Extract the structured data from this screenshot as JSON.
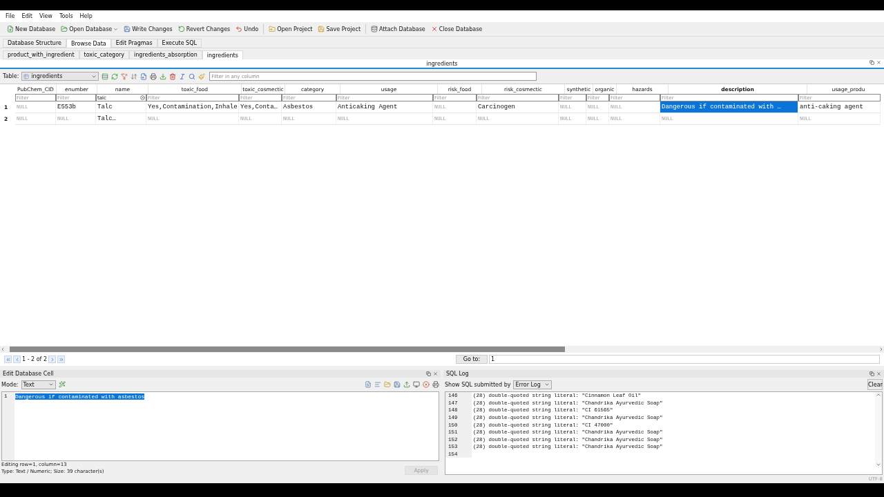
{
  "menu": [
    "File",
    "Edit",
    "View",
    "Tools",
    "Help"
  ],
  "toolbar": [
    {
      "label": "New Database"
    },
    {
      "label": "Open Database",
      "dropdown": true
    },
    {
      "label": "Write Changes"
    },
    {
      "label": "Revert Changes"
    },
    {
      "label": "Undo"
    },
    {
      "label": "Open Project",
      "group_start": true
    },
    {
      "label": "Save Project"
    },
    {
      "label": "Attach Database",
      "group_start": true
    },
    {
      "label": "Close Database"
    }
  ],
  "main_tabs": [
    {
      "label": "Database Structure",
      "selected": false
    },
    {
      "label": "Browse Data",
      "selected": true
    },
    {
      "label": "Edit Pragmas",
      "selected": false
    },
    {
      "label": "Execute SQL",
      "selected": false
    }
  ],
  "table_tabs": [
    {
      "label": "product_with_ingredient",
      "selected": false
    },
    {
      "label": "toxic_category",
      "selected": false
    },
    {
      "label": "ingredients_absorption",
      "selected": false
    },
    {
      "label": "ingredients",
      "selected": true
    }
  ],
  "view_title": "ingredients",
  "table_bar": {
    "label": "Table:",
    "table": "ingredients",
    "filter_placeholder": "Filter in any column"
  },
  "columns": [
    {
      "name": "PubChem_CID",
      "placeholder": "Filter",
      "current": false
    },
    {
      "name": "enumber",
      "placeholder": "Filter",
      "current": false
    },
    {
      "name": "name",
      "value": "talc",
      "current": false
    },
    {
      "name": "toxic_food",
      "placeholder": "Filter",
      "current": false
    },
    {
      "name": "toxic_cosmectic",
      "placeholder": "Filter",
      "current": false
    },
    {
      "name": "category",
      "placeholder": "Filter",
      "current": false
    },
    {
      "name": "usage",
      "placeholder": "Filter",
      "current": false
    },
    {
      "name": "risk_food",
      "placeholder": "Filter",
      "current": false
    },
    {
      "name": "risk_cosmectic",
      "placeholder": "Filter",
      "current": false
    },
    {
      "name": "synthetic",
      "placeholder": "Filter",
      "current": false
    },
    {
      "name": "organic",
      "placeholder": "Filter",
      "current": false
    },
    {
      "name": "hazards",
      "placeholder": "Filter",
      "current": false
    },
    {
      "name": "description",
      "placeholder": "Filter",
      "current": true
    },
    {
      "name": "usage_produ",
      "placeholder": "Filter",
      "current": false
    }
  ],
  "rows": [
    {
      "number": "1",
      "cells": [
        {
          "value": "NULL",
          "null": true,
          "selected": false
        },
        {
          "value": "E553b",
          "null": false,
          "selected": false
        },
        {
          "value": "Talc",
          "null": false,
          "selected": false
        },
        {
          "value": "Yes,Contamination,Inhale",
          "null": false,
          "selected": false
        },
        {
          "value": "Yes,Conta…",
          "null": false,
          "selected": false
        },
        {
          "value": "Asbestos",
          "null": false,
          "selected": false
        },
        {
          "value": "Anticaking Agent",
          "null": false,
          "selected": false
        },
        {
          "value": "NULL",
          "null": true,
          "selected": false
        },
        {
          "value": "Carcinogen",
          "null": false,
          "selected": false
        },
        {
          "value": "NULL",
          "null": true,
          "selected": false
        },
        {
          "value": "NULL",
          "null": true,
          "selected": false
        },
        {
          "value": "NULL",
          "null": true,
          "selected": false
        },
        {
          "value": "Dangerous if contaminated with …",
          "null": false,
          "selected": true
        },
        {
          "value": "anti-caking agent",
          "null": false,
          "selected": false
        }
      ]
    },
    {
      "number": "2",
      "cells": [
        {
          "value": "NULL",
          "null": true,
          "selected": false
        },
        {
          "value": "NULL",
          "null": true,
          "selected": false
        },
        {
          "value": "Talc…",
          "null": false,
          "selected": false
        },
        {
          "value": "NULL",
          "null": true,
          "selected": false
        },
        {
          "value": "NULL",
          "null": true,
          "selected": false
        },
        {
          "value": "NULL",
          "null": true,
          "selected": false
        },
        {
          "value": "NULL",
          "null": true,
          "selected": false
        },
        {
          "value": "NULL",
          "null": true,
          "selected": false
        },
        {
          "value": "NULL",
          "null": true,
          "selected": false
        },
        {
          "value": "NULL",
          "null": true,
          "selected": false
        },
        {
          "value": "NULL",
          "null": true,
          "selected": false
        },
        {
          "value": "NULL",
          "null": true,
          "selected": false
        },
        {
          "value": "NULL",
          "null": true,
          "selected": false
        },
        {
          "value": "NULL",
          "null": true,
          "selected": false
        }
      ]
    }
  ],
  "navigator": {
    "range": "1 - 2 of 2",
    "goto_label": "Go to:",
    "goto_value": "1"
  },
  "edit_cell": {
    "title": "Edit Database Cell",
    "mode_label": "Mode:",
    "mode": "Text",
    "line_number": "1",
    "text": "Dangerous if contaminated with asbestos",
    "status": [
      "Editing row=1, column=13",
      "Type: Text / Numeric; Size: 39 character(s)"
    ],
    "apply": "Apply"
  },
  "sql_log": {
    "title": "SQL Log",
    "submitted_label": "Show SQL submitted by",
    "submitted_by": "Error Log",
    "clear": "Clear",
    "lines": [
      {
        "number": "146",
        "text": "(28) double-quoted string literal: \"Cinnamon Leaf Oil\""
      },
      {
        "number": "147",
        "text": "(28) double-quoted string literal: \"Chandrika Ayurvedic Soap\""
      },
      {
        "number": "148",
        "text": "(28) double-quoted string literal: \"CI 61565\""
      },
      {
        "number": "149",
        "text": "(28) double-quoted string literal: \"Chandrika Ayurvedic Soap\""
      },
      {
        "number": "150",
        "text": "(28) double-quoted string literal: \"CI 47000\""
      },
      {
        "number": "151",
        "text": "(28) double-quoted string literal: \"Chandrika Ayurvedic Soap\""
      },
      {
        "number": "152",
        "text": "(28) double-quoted string literal: \"Chandrika Ayurvedic Soap\""
      },
      {
        "number": "153",
        "text": "(28) double-quoted string literal: \"Chandrika Ayurvedic Soap\""
      },
      {
        "number": "154"
      }
    ]
  },
  "encoding": "UTF-8"
}
